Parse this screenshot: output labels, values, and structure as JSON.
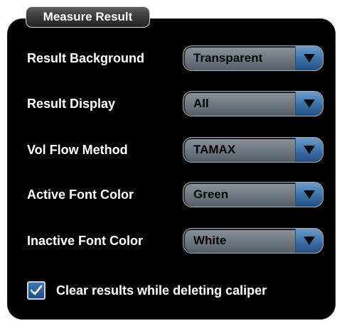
{
  "group": {
    "title": "Measure Result"
  },
  "settings": [
    {
      "label": "Result Background",
      "value": "Transparent"
    },
    {
      "label": "Result Display",
      "value": "All"
    },
    {
      "label": "Vol Flow Method",
      "value": "TAMAX"
    },
    {
      "label": "Active Font Color",
      "value": "Green"
    },
    {
      "label": "Inactive Font Color",
      "value": "White"
    }
  ],
  "clear_results": {
    "label": "Clear results while deleting caliper",
    "checked": true
  },
  "icons": {
    "dropdown": "chevron-down-icon",
    "check": "checkmark-icon"
  },
  "colors": {
    "panel_background": "#000000",
    "combo_fill": "#7a838b",
    "arrow_button": "#3f74aa",
    "checkbox_fill": "#2a5f9c"
  }
}
